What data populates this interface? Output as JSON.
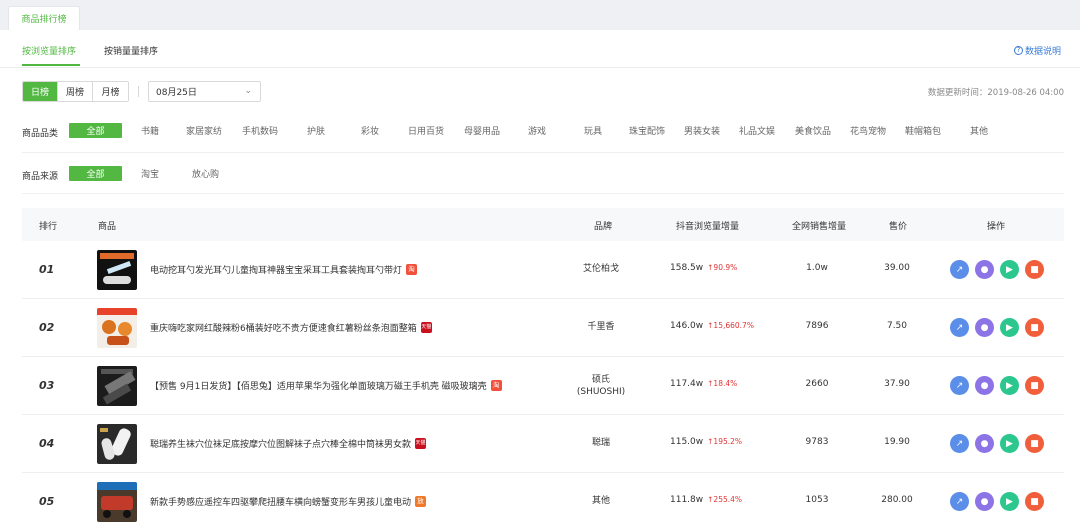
{
  "top_tab": "商品排行榜",
  "subtabs": [
    "按浏览量排序",
    "按销量量排序"
  ],
  "explain": "数据说明",
  "period": [
    "日榜",
    "周榜",
    "月榜"
  ],
  "date_value": "08月25日",
  "updated": "数据更新时间：2019-08-26 04:00",
  "category": {
    "label": "商品品类",
    "items": [
      "全部",
      "书籍",
      "家居家纺",
      "手机数码",
      "护肤",
      "彩妆",
      "日用百货",
      "母婴用品",
      "游戏",
      "玩具",
      "珠宝配饰",
      "男装女装",
      "礼品文娱",
      "美食饮品",
      "花鸟宠物",
      "鞋帽箱包",
      "其他"
    ]
  },
  "source": {
    "label": "商品来源",
    "items": [
      "全部",
      "淘宝",
      "放心购"
    ]
  },
  "headers": [
    "排行",
    "商品",
    "品牌",
    "抖音浏览量增量",
    "全网销售增量",
    "售价",
    "操作"
  ],
  "rows": [
    {
      "rank": "01",
      "name": "电动挖耳勺发光耳勺儿童掏耳神器宝宝采耳工具套装掏耳勺带灯",
      "tag": "淘",
      "brand": "艾伦柏戈",
      "views": "158.5w",
      "pct": "↑90.9%",
      "sales": "1.0w",
      "price": "39.00"
    },
    {
      "rank": "02",
      "name": "重庆嗨吃家网红酸辣粉6桶装好吃不贵方便速食红薯粉丝条泡面整箱",
      "tag": "天猫",
      "brand": "千里香",
      "views": "146.0w",
      "pct": "↑15,660.7%",
      "sales": "7896",
      "price": "7.50"
    },
    {
      "rank": "03",
      "name": "【预售 9月1日发货】【佰思兔】适用苹果华为强化单面玻璃万磁王手机壳 磁吸玻璃壳",
      "tag": "淘",
      "brand": "硕氏\n(SHUOSHI)",
      "views": "117.4w",
      "pct": "↑18.4%",
      "sales": "2660",
      "price": "37.90"
    },
    {
      "rank": "04",
      "name": "聪瑞养生袜穴位袜足底按摩穴位图解袜子点穴棒全棉中筒袜男女款",
      "tag": "天猫",
      "brand": "聪瑞",
      "views": "115.0w",
      "pct": "↑195.2%",
      "sales": "9783",
      "price": "19.90"
    },
    {
      "rank": "05",
      "name": "新款手势感应遥控车四驱攀爬扭腰车横向螃蟹变形车男孩儿童电动",
      "tag": "放",
      "brand": "其他",
      "views": "111.8w",
      "pct": "↑255.4%",
      "sales": "1053",
      "price": "280.00"
    }
  ],
  "colors": {
    "accent": "#52b842",
    "tag_taobao": "#f0503c",
    "tag_tmall": "#c8101e",
    "tag_fxg": "#f07a2c",
    "up": "#e03434"
  }
}
